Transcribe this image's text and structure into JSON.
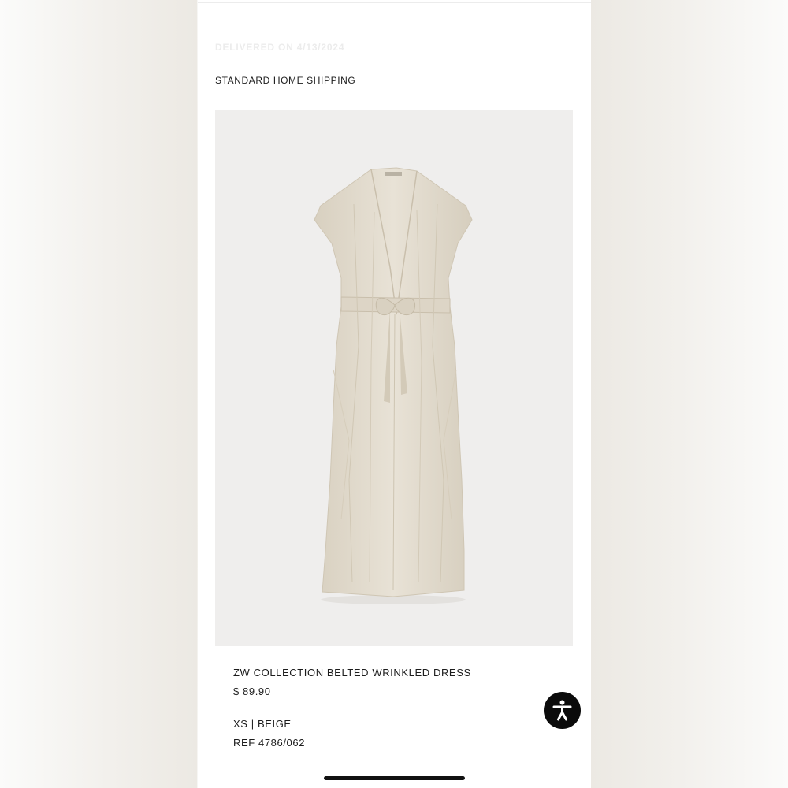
{
  "order": {
    "status_text": "DELIVERED ON 4/13/2024",
    "shipping_method": "STANDARD HOME SHIPPING"
  },
  "product": {
    "name": "ZW COLLECTION BELTED WRINKLED DRESS",
    "price": "$ 89.90",
    "variant": "XS | BEIGE",
    "reference": "REF 4786/062",
    "image_description_icon": "beige-belted-dress-image"
  },
  "icons": {
    "menu": "hamburger-menu-icon",
    "accessibility": "accessibility-icon"
  },
  "colors": {
    "background": "#ffffff",
    "image_background": "#efeeed",
    "dress": "#e4ddcf",
    "text": "#1c1c1c",
    "status_faded": "#ececec",
    "accessibility_button": "#0b0b0b"
  }
}
